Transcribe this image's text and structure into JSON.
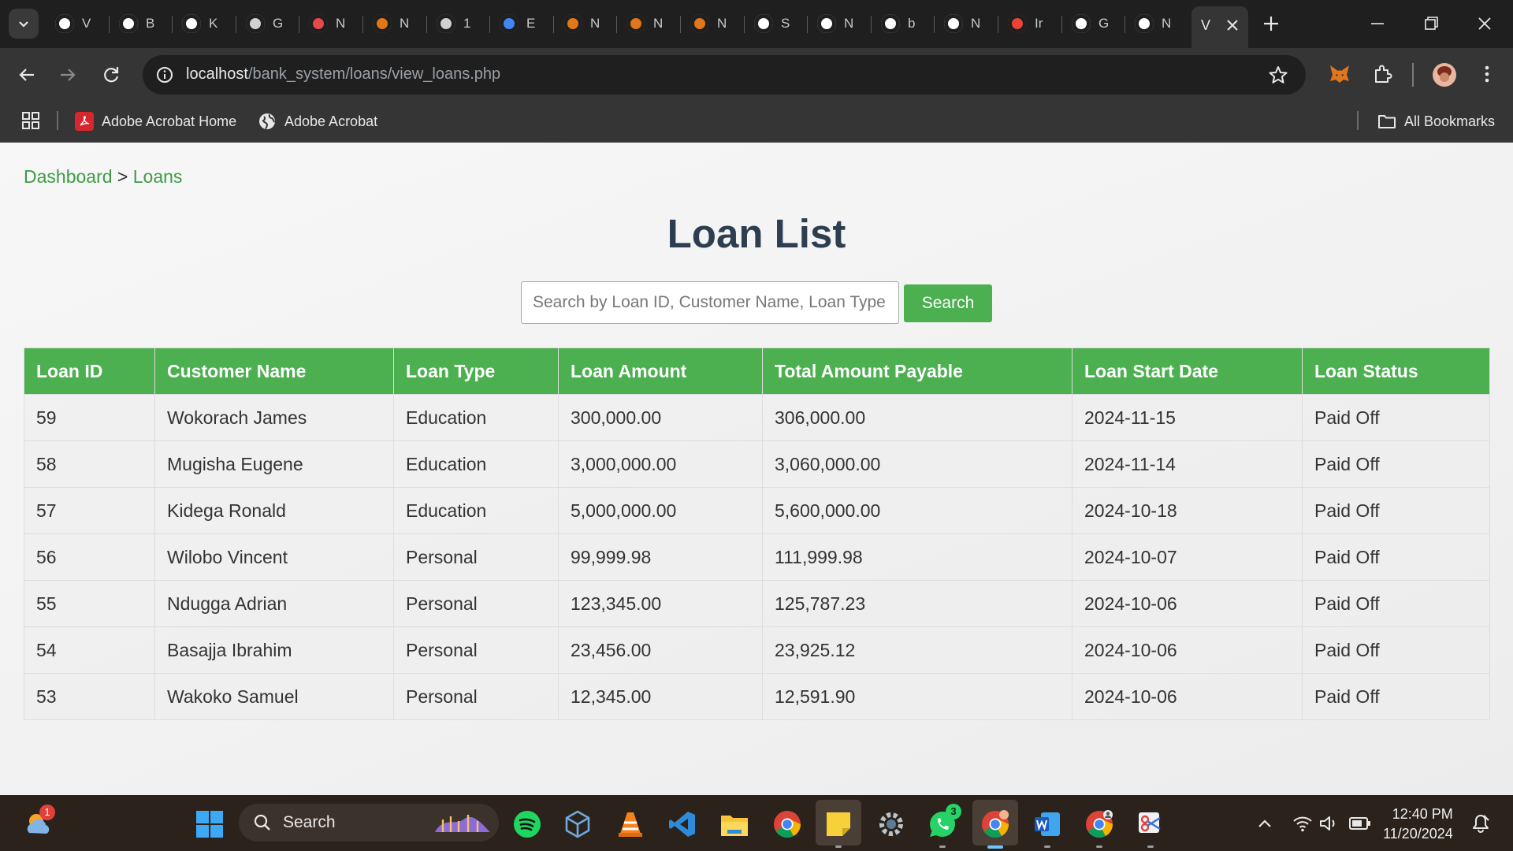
{
  "browser": {
    "tabs": [
      {
        "title": "V",
        "icon": "chrome-icon",
        "color": "#ffffff"
      },
      {
        "title": "B",
        "icon": "openai-icon",
        "color": "#ffffff"
      },
      {
        "title": "K",
        "icon": "github-icon",
        "color": "#ffffff"
      },
      {
        "title": "G",
        "icon": "generic-site-icon",
        "color": "#d0d0d0"
      },
      {
        "title": "N",
        "icon": "flag-icon",
        "color": "#e8484b"
      },
      {
        "title": "N",
        "icon": "metamask-icon",
        "color": "#e2761b"
      },
      {
        "title": "1",
        "icon": "globe-icon",
        "color": "#d0d0d0"
      },
      {
        "title": "E",
        "icon": "google-cloud-icon",
        "color": "#4285f4"
      },
      {
        "title": "N",
        "icon": "metamask-icon",
        "color": "#e2761b"
      },
      {
        "title": "N",
        "icon": "metamask-icon",
        "color": "#e2761b"
      },
      {
        "title": "N",
        "icon": "metamask-icon",
        "color": "#e2761b"
      },
      {
        "title": "S",
        "icon": "stats-icon",
        "color": "#ffffff"
      },
      {
        "title": "N",
        "icon": "github-icon",
        "color": "#ffffff"
      },
      {
        "title": "b",
        "icon": "google-icon",
        "color": "#ffffff"
      },
      {
        "title": "N",
        "icon": "chrome-icon",
        "color": "#ffffff"
      },
      {
        "title": "Ir",
        "icon": "gmail-icon",
        "color": "#ea4335"
      },
      {
        "title": "G",
        "icon": "google-lens-icon",
        "color": "#ffffff"
      },
      {
        "title": "N",
        "icon": "chrome-icon",
        "color": "#ffffff"
      }
    ],
    "active_tab": {
      "title": "V"
    },
    "url_host": "localhost",
    "url_path": "/bank_system/loans/view_loans.php",
    "bookmarks": [
      {
        "label": "Adobe Acrobat Home",
        "icon": "adobe-acrobat-icon"
      },
      {
        "label": "Adobe Acrobat",
        "icon": "globe-icon"
      }
    ],
    "all_bookmarks_label": "All Bookmarks"
  },
  "page": {
    "breadcrumb": {
      "home": "Dashboard",
      "separator": " > ",
      "current": "Loans"
    },
    "title": "Loan List",
    "search": {
      "placeholder": "Search by Loan ID, Customer Name, Loan Type",
      "value": "",
      "button_label": "Search"
    },
    "table": {
      "columns": [
        "Loan ID",
        "Customer Name",
        "Loan Type",
        "Loan Amount",
        "Total Amount Payable",
        "Loan Start Date",
        "Loan Status"
      ],
      "rows": [
        [
          "59",
          "Wokorach James",
          "Education",
          "300,000.00",
          "306,000.00",
          "2024-11-15",
          "Paid Off"
        ],
        [
          "58",
          "Mugisha Eugene",
          "Education",
          "3,000,000.00",
          "3,060,000.00",
          "2024-11-14",
          "Paid Off"
        ],
        [
          "57",
          "Kidega Ronald",
          "Education",
          "5,000,000.00",
          "5,600,000.00",
          "2024-10-18",
          "Paid Off"
        ],
        [
          "56",
          "Wilobo Vincent",
          "Personal",
          "99,999.98",
          "111,999.98",
          "2024-10-07",
          "Paid Off"
        ],
        [
          "55",
          "Ndugga Adrian",
          "Personal",
          "123,345.00",
          "125,787.23",
          "2024-10-06",
          "Paid Off"
        ],
        [
          "54",
          "Basajja Ibrahim",
          "Personal",
          "23,456.00",
          "23,925.12",
          "2024-10-06",
          "Paid Off"
        ],
        [
          "53",
          "Wakoko Samuel",
          "Personal",
          "12,345.00",
          "12,591.90",
          "2024-10-06",
          "Paid Off"
        ]
      ]
    },
    "colors": {
      "accent": "#4caf50",
      "link": "#3e9b47",
      "title": "#2c3e50"
    }
  },
  "taskbar": {
    "search_label": "Search",
    "time": "12:40 PM",
    "date": "11/20/2024",
    "weather_badge": "1",
    "whatsapp_badge": "3",
    "apps": [
      "weather-icon",
      "windows-start-icon",
      "search-icon",
      "spotify-icon",
      "virtualbox-icon",
      "vlc-icon",
      "vscode-icon",
      "file-explorer-icon",
      "chrome-icon",
      "sticky-notes-icon",
      "settings-icon",
      "whatsapp-icon",
      "chrome-dev-icon",
      "word-icon",
      "chrome-profile-icon",
      "snipping-tool-icon"
    ]
  }
}
